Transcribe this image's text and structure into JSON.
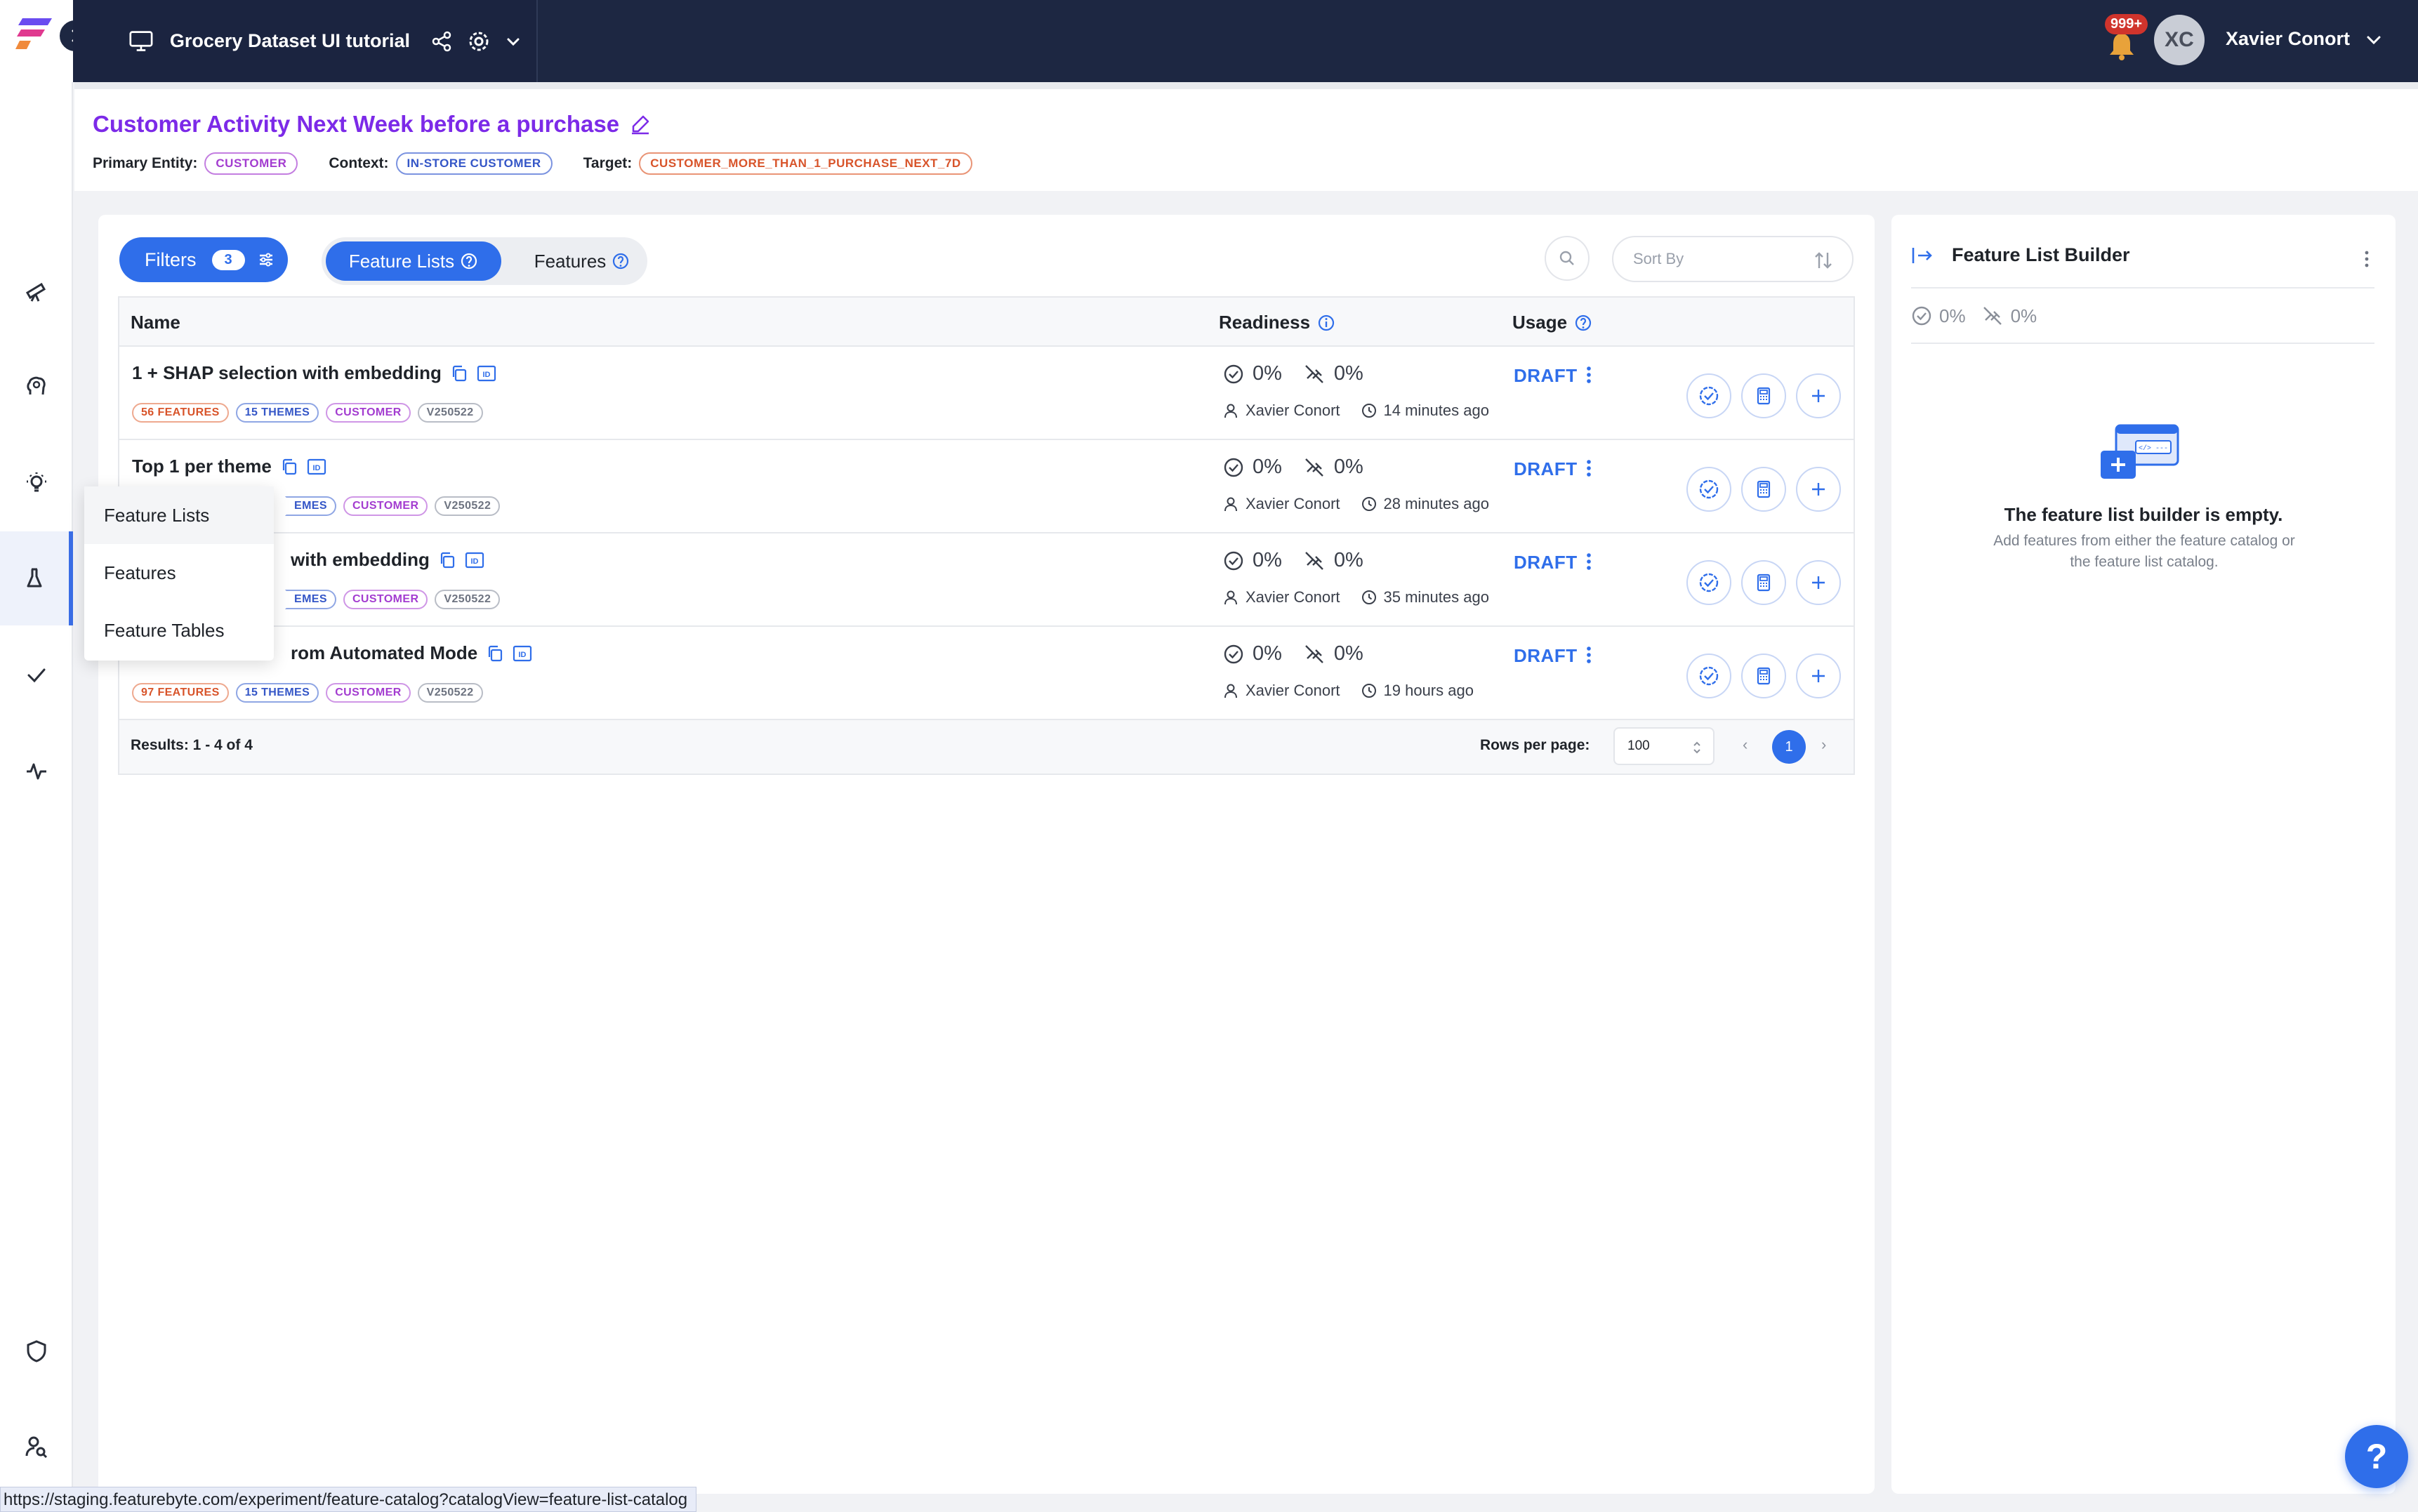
{
  "app": {
    "project_title": "Grocery Dataset UI tutorial",
    "notifications_badge": "999+",
    "user_initials": "XC",
    "user_name": "Xavier Conort"
  },
  "nav": {
    "flyout": [
      "Feature Lists",
      "Features",
      "Feature Tables"
    ],
    "active_item": "Feature Lists"
  },
  "header": {
    "title": "Customer Activity Next Week before a purchase",
    "primary_entity_label": "Primary Entity:",
    "primary_entity": "CUSTOMER",
    "context_label": "Context:",
    "context": "IN-STORE CUSTOMER",
    "target_label": "Target:",
    "target": "CUSTOMER_MORE_THAN_1_PURCHASE_NEXT_7D"
  },
  "toolbar": {
    "filters_label": "Filters",
    "filters_count": "3",
    "tab_feature_lists": "Feature Lists",
    "tab_features": "Features",
    "sort_placeholder": "Sort By"
  },
  "table": {
    "columns": {
      "name": "Name",
      "readiness": "Readiness",
      "usage": "Usage"
    },
    "rows": [
      {
        "name": "1 + SHAP selection with embedding",
        "tags": [
          "56 FEATURES",
          "15 THEMES",
          "CUSTOMER",
          "V250522"
        ],
        "readiness": "0%",
        "online": "0%",
        "owner": "Xavier Conort",
        "updated": "14 minutes ago",
        "status": "DRAFT"
      },
      {
        "name": "Top 1 per theme",
        "tags": [
          "",
          "EMES",
          "CUSTOMER",
          "V250522"
        ],
        "readiness": "0%",
        "online": "0%",
        "owner": "Xavier Conort",
        "updated": "28 minutes ago",
        "status": "DRAFT"
      },
      {
        "name": "with embedding",
        "tags": [
          "",
          "EMES",
          "CUSTOMER",
          "V250522"
        ],
        "readiness": "0%",
        "online": "0%",
        "owner": "Xavier Conort",
        "updated": "35 minutes ago",
        "status": "DRAFT"
      },
      {
        "name": "rom Automated Mode",
        "tags": [
          "97 FEATURES",
          "15 THEMES",
          "CUSTOMER",
          "V250522"
        ],
        "readiness": "0%",
        "online": "0%",
        "owner": "Xavier Conort",
        "updated": "19 hours ago",
        "status": "DRAFT"
      }
    ],
    "results": "Results: 1 - 4 of 4",
    "rows_per_page_label": "Rows per page:",
    "rows_per_page": "100",
    "current_page": "1"
  },
  "builder": {
    "title": "Feature List Builder",
    "readiness": "0%",
    "online": "0%",
    "empty_title": "The feature list builder is empty.",
    "empty_sub": "Add features from either the feature catalog or the feature list catalog."
  },
  "help_label": "?",
  "status_url": "https://staging.featurebyte.com/experiment/feature-catalog?catalogView=feature-list-catalog",
  "colors": {
    "accent": "#2f6eea",
    "title": "#7c2ae8",
    "topbar": "#1d2742"
  }
}
